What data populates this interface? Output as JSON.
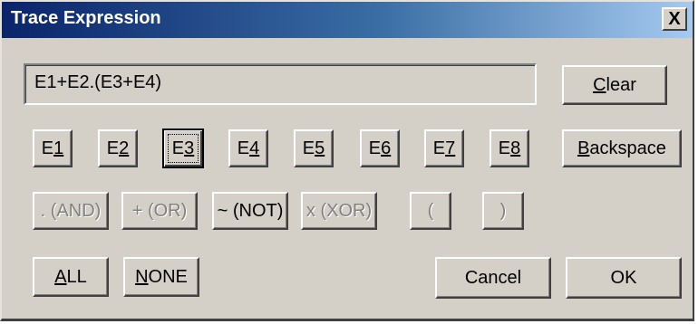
{
  "window": {
    "title": "Trace Expression",
    "close_symbol": "X"
  },
  "expression": {
    "value": "E1+E2.(E3+E4)"
  },
  "buttons": {
    "clear": {
      "pre": "",
      "key": "C",
      "post": "lear"
    },
    "backspace": {
      "pre": "",
      "key": "B",
      "post": "ackspace"
    },
    "events": [
      {
        "pre": "E",
        "key": "1",
        "post": ""
      },
      {
        "pre": "E",
        "key": "2",
        "post": ""
      },
      {
        "pre": "E",
        "key": "3",
        "post": ""
      },
      {
        "pre": "E",
        "key": "4",
        "post": ""
      },
      {
        "pre": "E",
        "key": "5",
        "post": ""
      },
      {
        "pre": "E",
        "key": "6",
        "post": ""
      },
      {
        "pre": "E",
        "key": "7",
        "post": ""
      },
      {
        "pre": "E",
        "key": "8",
        "post": ""
      }
    ],
    "operators": {
      "and": ". (AND)",
      "or": "+ (OR)",
      "not": "~ (NOT)",
      "xor": "x (XOR)",
      "open_paren": "(",
      "close_paren": ")"
    },
    "all": {
      "pre": "",
      "key": "A",
      "post": "LL"
    },
    "none": {
      "pre": "",
      "key": "N",
      "post": "ONE"
    },
    "cancel": "Cancel",
    "ok": "OK"
  },
  "state": {
    "focused_button": "E3"
  }
}
